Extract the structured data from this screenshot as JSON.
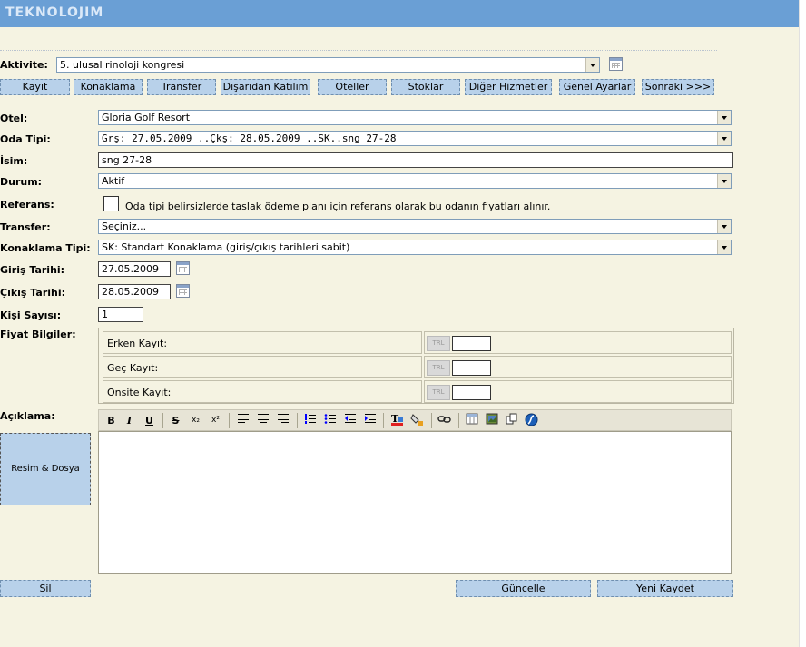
{
  "header": {
    "logo": "TEKNOLOJIM"
  },
  "activity": {
    "label": "Aktivite:",
    "value": "5. ulusal rinoloji kongresi"
  },
  "nav": [
    "Kayıt",
    "Konaklama",
    "Transfer",
    "Dışarıdan Katılım",
    "Oteller",
    "Stoklar",
    "Diğer Hizmetler",
    "Genel Ayarlar",
    "Sonraki >>>"
  ],
  "form": {
    "otel": {
      "label": "Otel:",
      "value": "Gloria Golf Resort"
    },
    "oda_tipi": {
      "label": "Oda Tipi:",
      "value": "Grş: 27.05.2009 ..Çkş: 28.05.2009 ..SK..sng 27-28"
    },
    "isim": {
      "label": "İsim:",
      "value": "sng 27-28"
    },
    "durum": {
      "label": "Durum:",
      "value": "Aktif"
    },
    "referans": {
      "label": "Referans:",
      "note": "Oda tipi belirsizlerde taslak ödeme planı için referans olarak bu odanın fiyatları alınır.",
      "checked": false
    },
    "transfer": {
      "label": "Transfer:",
      "value": "Seçiniz..."
    },
    "konaklama_tipi": {
      "label": "Konaklama Tipi:",
      "value": "SK: Standart Konaklama (giriş/çıkış tarihleri sabit)"
    },
    "giris": {
      "label": "Giriş Tarihi:",
      "value": "27.05.2009"
    },
    "cikis": {
      "label": "Çıkış Tarihi:",
      "value": "28.05.2009"
    },
    "kisi": {
      "label": "Kişi Sayısı:",
      "value": "1"
    },
    "fiyat": {
      "label": "Fiyat Bilgiler:",
      "rows": [
        {
          "label": "Erken Kayıt:"
        },
        {
          "label": "Geç Kayıt:"
        },
        {
          "label": "Onsite Kayıt:"
        }
      ]
    },
    "aciklama": {
      "label": "Açıklama:"
    }
  },
  "toolbar": {
    "bold": "B",
    "italic": "I",
    "underline": "U",
    "strike": "S",
    "sub": "x₂",
    "sup": "x²"
  },
  "buttons": {
    "media": "Resim & Dosya",
    "delete": "Sil",
    "update": "Güncelle",
    "save_new": "Yeni Kaydet"
  }
}
